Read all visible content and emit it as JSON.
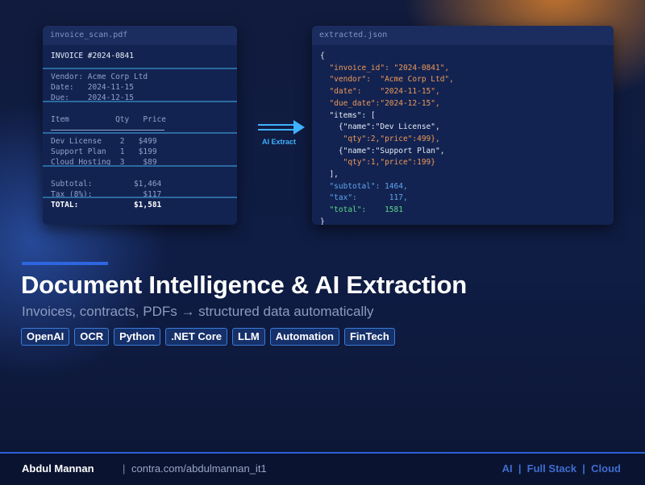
{
  "invoice_panel": {
    "filename": "invoice_scan.pdf",
    "title": "INVOICE #2024-0841",
    "vendor": "Vendor: Acme Corp Ltd",
    "date": "Date:   2024-11-15",
    "due": "Due:    2024-12-15",
    "table_header": "Item          Qty   Price",
    "items": [
      "Dev License    2   $499",
      "Support Plan   1   $199",
      "Cloud Hosting  3    $89"
    ],
    "subtotal": "Subtotal:         $1,464",
    "tax": "Tax (8%):           $117",
    "total": "TOTAL:            $1,581"
  },
  "arrow": {
    "label": "AI Extract",
    "color": "#3fb1ff"
  },
  "json_panel": {
    "filename": "extracted.json",
    "lines": [
      {
        "text": "{",
        "color": "jw"
      },
      {
        "parts": [
          {
            "t": "  \"invoice_id\": \"2024-0841\",",
            "c": "jk"
          }
        ]
      },
      {
        "parts": [
          {
            "t": "  \"vendor\":  \"Acme Corp Ltd\",",
            "c": "jk"
          }
        ]
      },
      {
        "parts": [
          {
            "t": "  \"date\":    \"2024-11-15\",",
            "c": "jk"
          }
        ]
      },
      {
        "parts": [
          {
            "t": "  \"due_date\":\"2024-12-15\",",
            "c": "jk"
          }
        ]
      },
      {
        "parts": [
          {
            "t": "  \"items\": [",
            "c": "jw"
          }
        ]
      },
      {
        "parts": [
          {
            "t": "    {\"name\":\"Dev License\",",
            "c": "jw"
          }
        ]
      },
      {
        "parts": [
          {
            "t": "     \"qty\":2,\"price\":499},",
            "c": "jk"
          }
        ]
      },
      {
        "parts": [
          {
            "t": "    {\"name\":\"Support Plan\",",
            "c": "jw"
          }
        ]
      },
      {
        "parts": [
          {
            "t": "     \"qty\":1,\"price\":199}",
            "c": "jk"
          }
        ]
      },
      {
        "parts": [
          {
            "t": "  ],",
            "c": "jw"
          }
        ]
      },
      {
        "parts": [
          {
            "t": "  \"subtotal\": 1464,",
            "c": "jn"
          }
        ]
      },
      {
        "parts": [
          {
            "t": "  \"tax\":       117,",
            "c": "jn"
          }
        ]
      },
      {
        "parts": [
          {
            "t": "  \"total\":    ",
            "c": "jg"
          },
          {
            "t": "1581",
            "c": "jg"
          }
        ]
      },
      {
        "parts": [
          {
            "t": "}",
            "c": "jw"
          }
        ]
      }
    ]
  },
  "headline": {
    "title": "Document Intelligence & AI Extraction",
    "subtitle": "Invoices, contracts, PDFs → structured data automatically"
  },
  "tags": [
    "OpenAI",
    "OCR",
    "Python",
    ".NET Core",
    "LLM",
    "Automation",
    "FinTech"
  ],
  "footer": {
    "name": "Abdul Mannan",
    "separator": "|",
    "url": "contra.com/abdulmannan_it1",
    "right": "AI  |  Full Stack  |  Cloud"
  },
  "colors": {
    "background": "#0e1a3c",
    "accent": "#2d66e0",
    "json_key": "#ee9a58",
    "json_number": "#5fa6ec",
    "json_total": "#5bd68a"
  }
}
